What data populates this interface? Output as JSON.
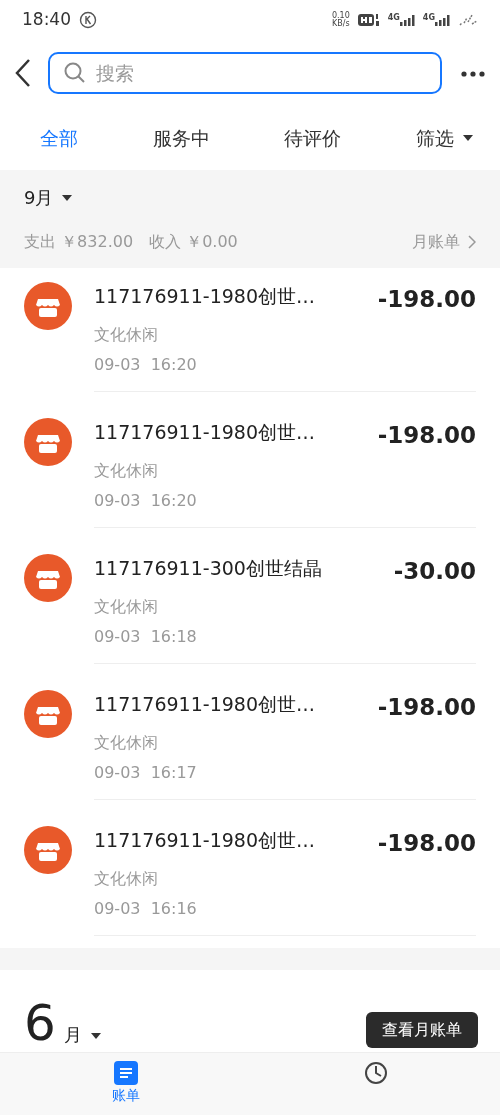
{
  "status_bar": {
    "time": "18:40",
    "speed": "0.10",
    "speed_unit": "KB/s",
    "network_1": "4G",
    "network_2": "4G"
  },
  "search": {
    "placeholder": "搜索"
  },
  "tabs": [
    {
      "label": "全部",
      "selected": true
    },
    {
      "label": "服务中",
      "selected": false
    },
    {
      "label": "待评价",
      "selected": false
    }
  ],
  "filter": {
    "label": "筛选"
  },
  "current_month": {
    "label": "9月",
    "expense": "支出 ￥832.00",
    "income": "收入 ￥0.00",
    "monthly_bill_link": "月账单"
  },
  "transactions": [
    {
      "title": "117176911-1980创世…",
      "category": "文化休闲",
      "time": "09-03  16:20",
      "amount": "-198.00"
    },
    {
      "title": "117176911-1980创世…",
      "category": "文化休闲",
      "time": "09-03  16:20",
      "amount": "-198.00"
    },
    {
      "title": "117176911-300创世结晶",
      "category": "文化休闲",
      "time": "09-03  16:18",
      "amount": "-30.00"
    },
    {
      "title": "117176911-1980创世…",
      "category": "文化休闲",
      "time": "09-03  16:17",
      "amount": "-198.00"
    },
    {
      "title": "117176911-1980创世…",
      "category": "文化休闲",
      "time": "09-03  16:16",
      "amount": "-198.00"
    }
  ],
  "next_month": {
    "number": "6",
    "unit": "月",
    "view_button": "查看月账单"
  },
  "bottom_nav": [
    {
      "kind": "bill",
      "label": "账单",
      "selected": true
    },
    {
      "kind": "clock",
      "selected": false
    }
  ]
}
